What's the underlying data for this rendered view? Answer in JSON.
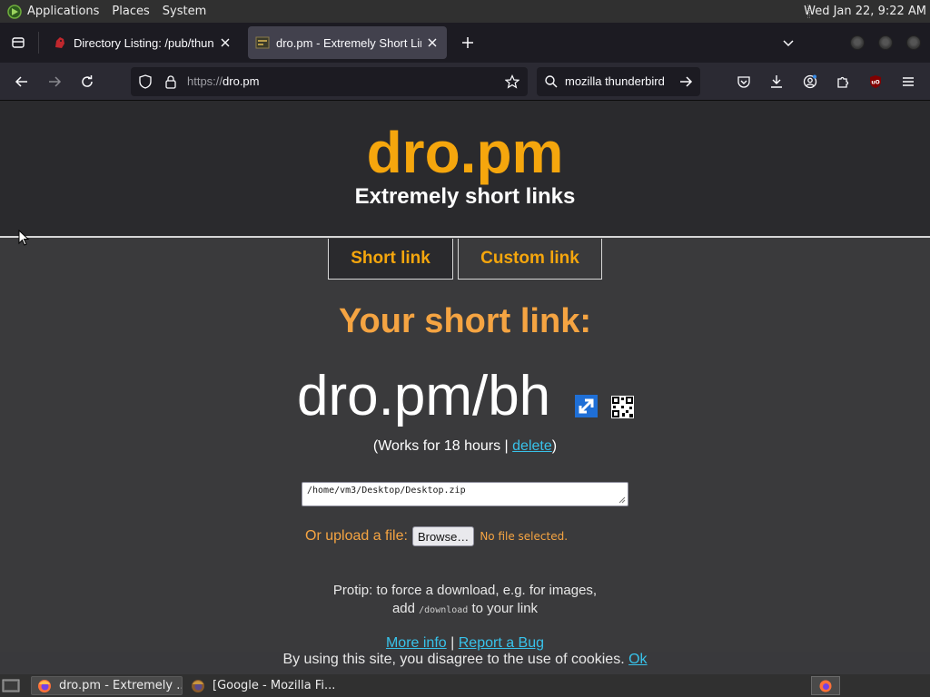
{
  "panel": {
    "applications": "Applications",
    "places": "Places",
    "system": "System",
    "clock": "Wed Jan 22,  9:22 AM"
  },
  "tabs": [
    {
      "title": "Directory Listing: /pub/thunderbird",
      "active": false
    },
    {
      "title": "dro.pm - Extremely Short Links",
      "active": true
    }
  ],
  "navbar": {
    "url_scheme": "https://",
    "url_host": "dro.pm",
    "search_query": "mozilla thunderbird"
  },
  "page": {
    "logo": "dro.pm",
    "tagline": "Extremely short links",
    "tabs": [
      "Short link",
      "Custom link"
    ],
    "result_heading": "Your short link:",
    "short_link": "dro.pm/bh",
    "works_for_prefix": "(Works for 18 hours | ",
    "delete_link": "delete",
    "works_for_suffix": ")",
    "path_value": "/home/vm3/Desktop/Desktop.zip",
    "upload_label": "Or upload a file:",
    "browse_button": "Browse…",
    "no_file": "No file selected.",
    "protip_line1": "Protip: to force a download, e.g. for images,",
    "protip_add": "add",
    "protip_code": "/download",
    "protip_line2_end": "to your link",
    "more_info": "More info",
    "separator": "|",
    "report_bug": "Report a Bug",
    "cookie_text": "By using this site, you disagree to the use of cookies.",
    "cookie_ok": "Ok"
  },
  "taskbar": {
    "tasks": [
      {
        "title": "dro.pm - Extremely ...",
        "active": true
      },
      {
        "title": "[Google - Mozilla Fi...",
        "active": false
      }
    ]
  },
  "colors": {
    "accent_orange": "#f5a60d",
    "link_blue": "#38c2ea",
    "page_bg": "#3a3a3c"
  }
}
